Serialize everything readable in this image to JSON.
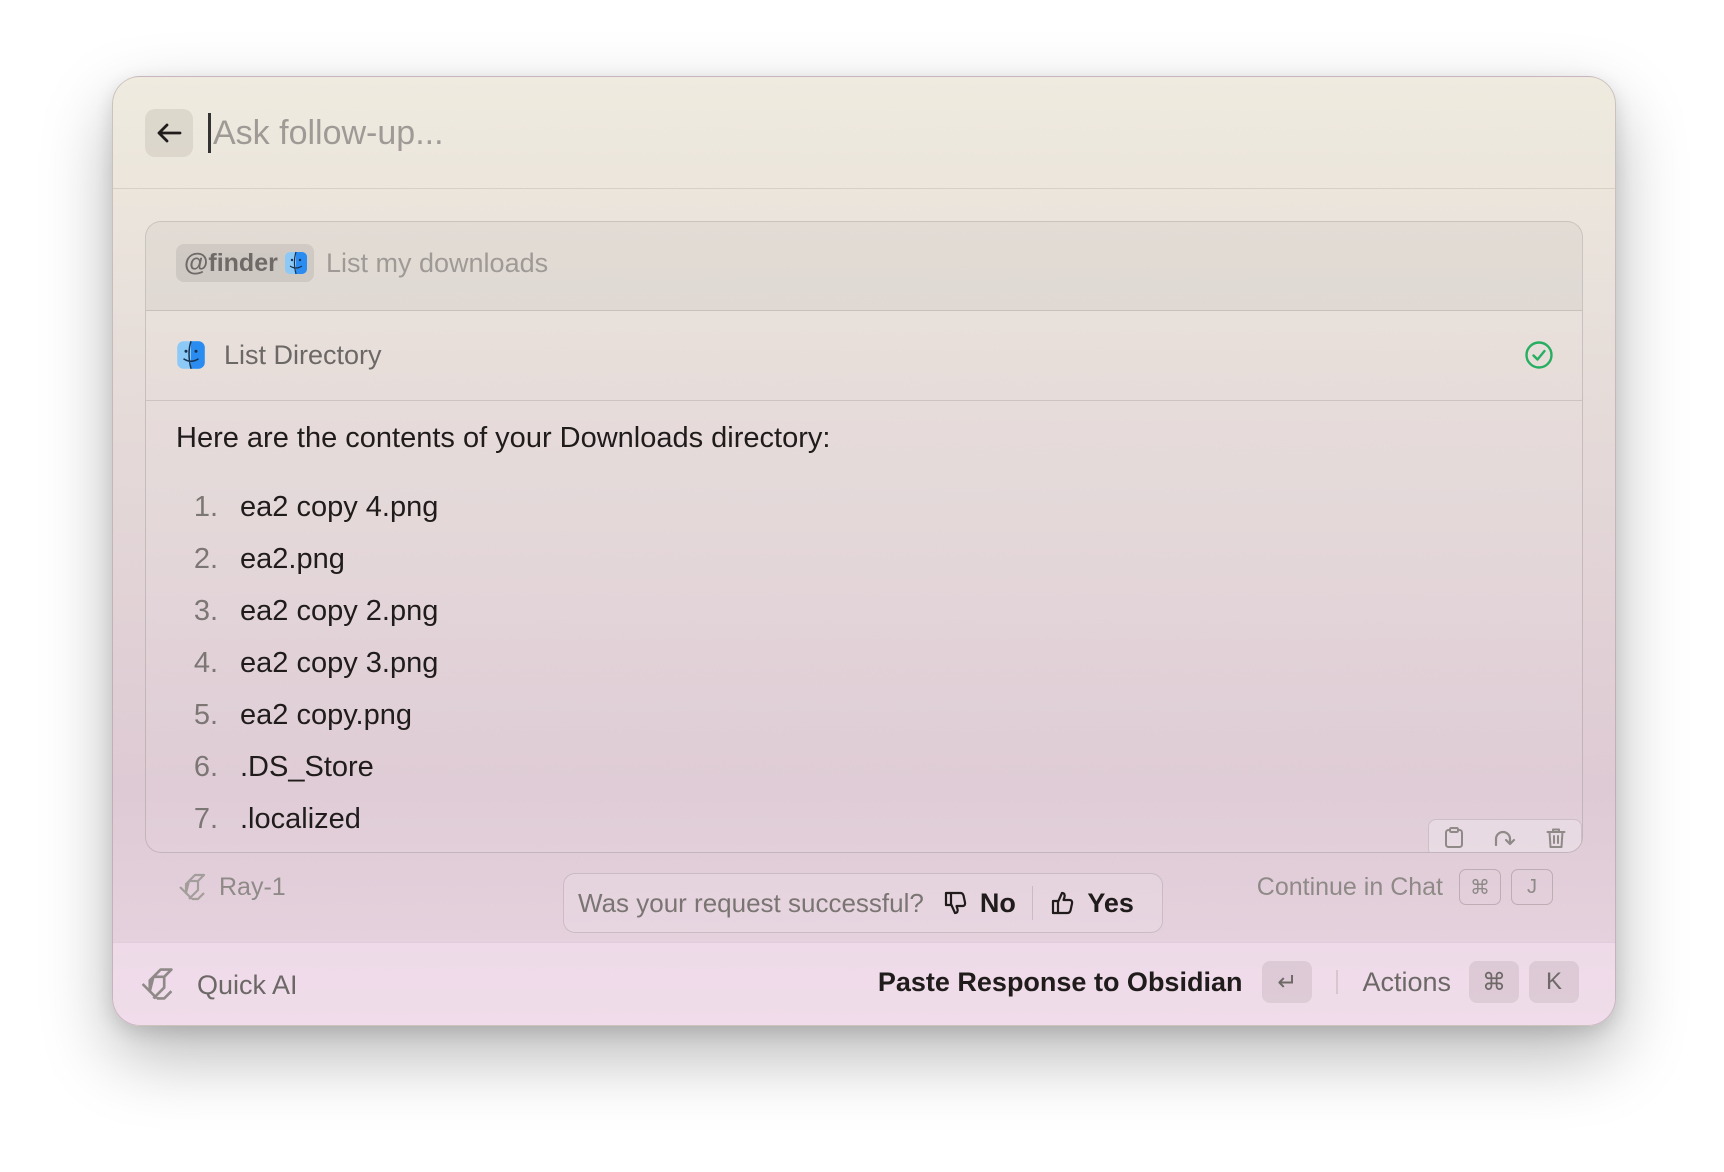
{
  "header": {
    "back_icon": "arrow-left-icon",
    "followup_placeholder": "Ask follow-up..."
  },
  "prompt": {
    "mention": "@finder",
    "mention_icon": "finder-icon",
    "text": "List my downloads"
  },
  "tool": {
    "icon": "finder-icon",
    "label": "List Directory",
    "status_icon": "check-circle-icon",
    "status_color": "#27ae60"
  },
  "response": {
    "intro": "Here are the contents of your Downloads directory:",
    "items": [
      {
        "num": "1.",
        "name": "ea2 copy 4.png"
      },
      {
        "num": "2.",
        "name": "ea2.png"
      },
      {
        "num": "3.",
        "name": "ea2 copy 2.png"
      },
      {
        "num": "4.",
        "name": "ea2 copy 3.png"
      },
      {
        "num": "5.",
        "name": "ea2 copy.png"
      },
      {
        "num": "6.",
        "name": ".DS_Store"
      },
      {
        "num": "7.",
        "name": ".localized"
      }
    ],
    "action_icons": [
      "clipboard-icon",
      "redo-icon",
      "trash-icon"
    ]
  },
  "model": {
    "icon": "raycast-logo-icon",
    "label": "Ray-1"
  },
  "feedback": {
    "question": "Was your request successful?",
    "no_label": "No",
    "no_icon": "thumbs-down-icon",
    "yes_label": "Yes",
    "yes_icon": "thumbs-up-icon"
  },
  "continue": {
    "label": "Continue in Chat",
    "keys": [
      "⌘",
      "J"
    ]
  },
  "footer": {
    "logo_icon": "raycast-logo-icon",
    "label": "Quick AI",
    "primary_action": "Paste Response to Obsidian",
    "primary_key": "↵",
    "actions_label": "Actions",
    "actions_keys": [
      "⌘",
      "K"
    ]
  },
  "colors": {
    "accent_green": "#27ae60",
    "finder_blue": "#2a8cf0"
  }
}
